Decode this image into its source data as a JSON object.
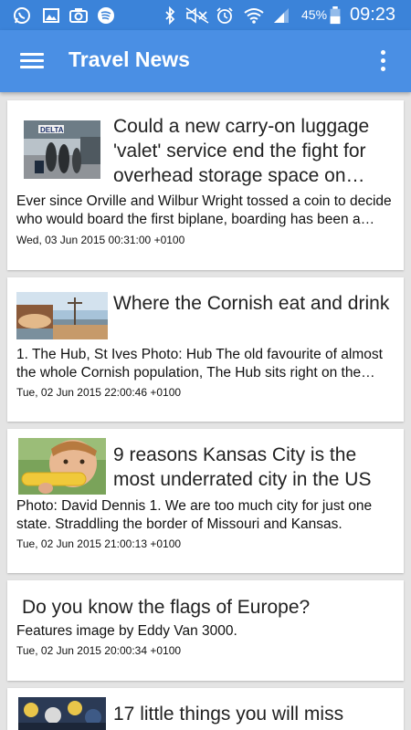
{
  "status_bar": {
    "battery_percent": "45%",
    "time": "09:23",
    "icons": [
      "whatsapp-icon",
      "gallery-icon",
      "camera-icon",
      "spotify-icon",
      "bluetooth-icon",
      "mute-icon",
      "alarm-icon",
      "wifi-icon",
      "signal-icon",
      "battery-icon"
    ]
  },
  "app_bar": {
    "title": "Travel News",
    "menu_icon": "hamburger-menu-icon",
    "overflow_icon": "more-vert-icon",
    "color": "#4a8fe4"
  },
  "articles": [
    {
      "title": "Could a new carry-on luggage 'valet' service end the fight for overhead storage space on board?",
      "summary": "Ever since Orville and Wilbur Wright tossed a coin to decide who would board the first biplane, boarding has been a battle.",
      "date": "Wed, 03 Jun 2015 00:31:00 +0100",
      "image_label": "DELTA"
    },
    {
      "title": "Where the Cornish eat and drink",
      "summary": "1. The Hub, St Ives     Photo: Hub  The old favourite of almost the whole Cornish population, The Hub sits right on the harbour.",
      "date": "Tue, 02 Jun 2015 22:00:46 +0100"
    },
    {
      "title": "9 reasons Kansas City is the most underrated city in the US",
      "summary": "Photo: David Dennis  1. We are too much city for just one state.  Straddling the border of Missouri and Kansas.",
      "date": "Tue, 02 Jun 2015 21:00:13 +0100"
    },
    {
      "title": "Do you know the flags of Europe?",
      "summary": "Features image by Eddy Van 3000.",
      "date": "Tue, 02 Jun 2015 20:00:34 +0100"
    },
    {
      "title": "17 little things you will miss"
    }
  ]
}
